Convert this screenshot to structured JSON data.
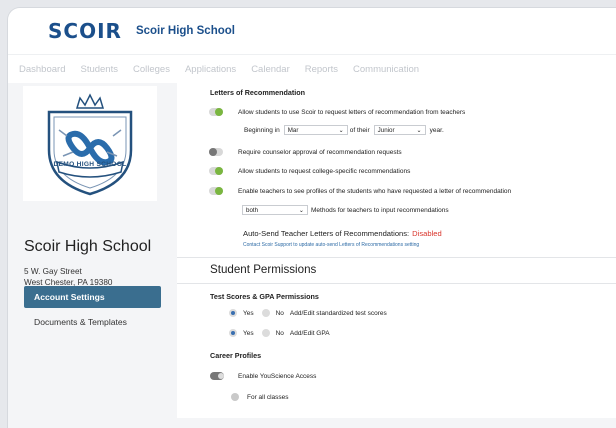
{
  "app": {
    "logo": "SCOIR",
    "school_name": "Scoir High School"
  },
  "nav": [
    "Dashboard",
    "Students",
    "Colleges",
    "Applications",
    "Calendar",
    "Reports",
    "Communication"
  ],
  "sidebar": {
    "crest_text": "DEMO HIGH SCHOOL",
    "title": "Scoir High School",
    "address_line1": "5 W. Gay Street",
    "address_line2": "West Chester, PA 19380",
    "account_settings": "Account Settings",
    "documents_templates": "Documents & Templates"
  },
  "letters": {
    "heading": "Letters of Recommendation",
    "allow_use": "Allow students to use Scoir to request letters of recommendation from teachers",
    "beginning_in": "Beginning in",
    "month": "Mar",
    "of_their": "of their",
    "grade": "Junior",
    "year": "year.",
    "require_approval": "Require counselor approval of recommendation requests",
    "allow_college_specific": "Allow students to request college-specific recommendations",
    "enable_profiles": "Enable teachers to see profiles of the students who have requested a letter of recommendation",
    "method_value": "both",
    "methods_label": "Methods for teachers to input recommendations",
    "auto_send_label": "Auto-Send Teacher Letters of Recommendations:",
    "auto_send_status": "Disabled",
    "support_link": "Contact Scoir Support to update auto-send Letters of Recommendations setting"
  },
  "student_permissions": {
    "heading": "Student Permissions",
    "test_scores_heading": "Test Scores & GPA Permissions",
    "yes": "Yes",
    "no": "No",
    "add_edit_tests": "Add/Edit standardized test scores",
    "add_edit_gpa": "Add/Edit GPA"
  },
  "career": {
    "heading": "Career Profiles",
    "enable_yousci": "Enable YouScience Access",
    "all_classes": "For all classes"
  },
  "colors": {
    "brand": "#1b4f8b",
    "button": "#3a6e8f",
    "toggle_on": "#7ab640",
    "disabled": "#d9342b"
  }
}
